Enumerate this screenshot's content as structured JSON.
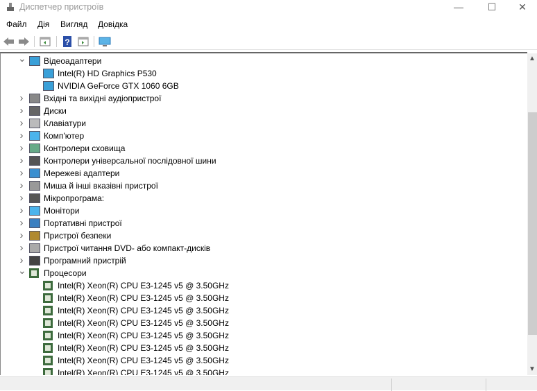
{
  "window": {
    "title": "Диспетчер пристроїв",
    "minimize": "—",
    "maximize": "☐",
    "close": "✕"
  },
  "menu": [
    "Файл",
    "Дія",
    "Вигляд",
    "Довідка"
  ],
  "toolbar": [
    "back-icon",
    "forward-icon",
    "properties-icon",
    "help-icon",
    "view-icon",
    "monitor-scan-icon"
  ],
  "tree": [
    {
      "label": "Відеоадаптери",
      "level": 0,
      "expanded": true,
      "icon": "display-adapter-icon"
    },
    {
      "label": "Intel(R) HD Graphics P530",
      "level": 1,
      "icon": "display-adapter-icon"
    },
    {
      "label": "NVIDIA GeForce GTX 1060 6GB",
      "level": 1,
      "icon": "display-adapter-icon"
    },
    {
      "label": "Вхідні та вихідні аудіопристрої",
      "level": 0,
      "expanded": false,
      "icon": "speaker-icon"
    },
    {
      "label": "Диски",
      "level": 0,
      "expanded": false,
      "icon": "disk-icon"
    },
    {
      "label": "Клавіатури",
      "level": 0,
      "expanded": false,
      "icon": "keyboard-icon"
    },
    {
      "label": "Комп'ютер",
      "level": 0,
      "expanded": false,
      "icon": "computer-icon"
    },
    {
      "label": "Контролери сховища",
      "level": 0,
      "expanded": false,
      "icon": "storage-controller-icon"
    },
    {
      "label": "Контролери універсальної послідовної шини",
      "level": 0,
      "expanded": false,
      "icon": "usb-icon"
    },
    {
      "label": "Мережеві адаптери",
      "level": 0,
      "expanded": false,
      "icon": "network-icon"
    },
    {
      "label": "Миша й інші вказівні пристрої",
      "level": 0,
      "expanded": false,
      "icon": "mouse-icon"
    },
    {
      "label": "Мікропрограма:",
      "level": 0,
      "expanded": false,
      "icon": "firmware-icon"
    },
    {
      "label": "Монітори",
      "level": 0,
      "expanded": false,
      "icon": "monitor-icon"
    },
    {
      "label": "Портативні пристрої",
      "level": 0,
      "expanded": false,
      "icon": "portable-device-icon"
    },
    {
      "label": "Пристрої безпеки",
      "level": 0,
      "expanded": false,
      "icon": "security-device-icon"
    },
    {
      "label": "Пристрої читання DVD- або компакт-дисків",
      "level": 0,
      "expanded": false,
      "icon": "dvd-icon"
    },
    {
      "label": "Програмний пристрій",
      "level": 0,
      "expanded": false,
      "icon": "software-device-icon"
    },
    {
      "label": "Процесори",
      "level": 0,
      "expanded": true,
      "icon": "processor-icon"
    },
    {
      "label": "Intel(R) Xeon(R) CPU E3-1245 v5 @ 3.50GHz",
      "level": 1,
      "icon": "processor-icon"
    },
    {
      "label": "Intel(R) Xeon(R) CPU E3-1245 v5 @ 3.50GHz",
      "level": 1,
      "icon": "processor-icon"
    },
    {
      "label": "Intel(R) Xeon(R) CPU E3-1245 v5 @ 3.50GHz",
      "level": 1,
      "icon": "processor-icon"
    },
    {
      "label": "Intel(R) Xeon(R) CPU E3-1245 v5 @ 3.50GHz",
      "level": 1,
      "icon": "processor-icon"
    },
    {
      "label": "Intel(R) Xeon(R) CPU E3-1245 v5 @ 3.50GHz",
      "level": 1,
      "icon": "processor-icon"
    },
    {
      "label": "Intel(R) Xeon(R) CPU E3-1245 v5 @ 3.50GHz",
      "level": 1,
      "icon": "processor-icon"
    },
    {
      "label": "Intel(R) Xeon(R) CPU E3-1245 v5 @ 3.50GHz",
      "level": 1,
      "icon": "processor-icon"
    },
    {
      "label": "Intel(R) Xeon(R) CPU E3-1245 v5 @ 3.50GHz",
      "level": 1,
      "icon": "processor-icon"
    }
  ],
  "scrollbar": {
    "position_fraction": 0.18,
    "visible_fraction": 0.72
  }
}
